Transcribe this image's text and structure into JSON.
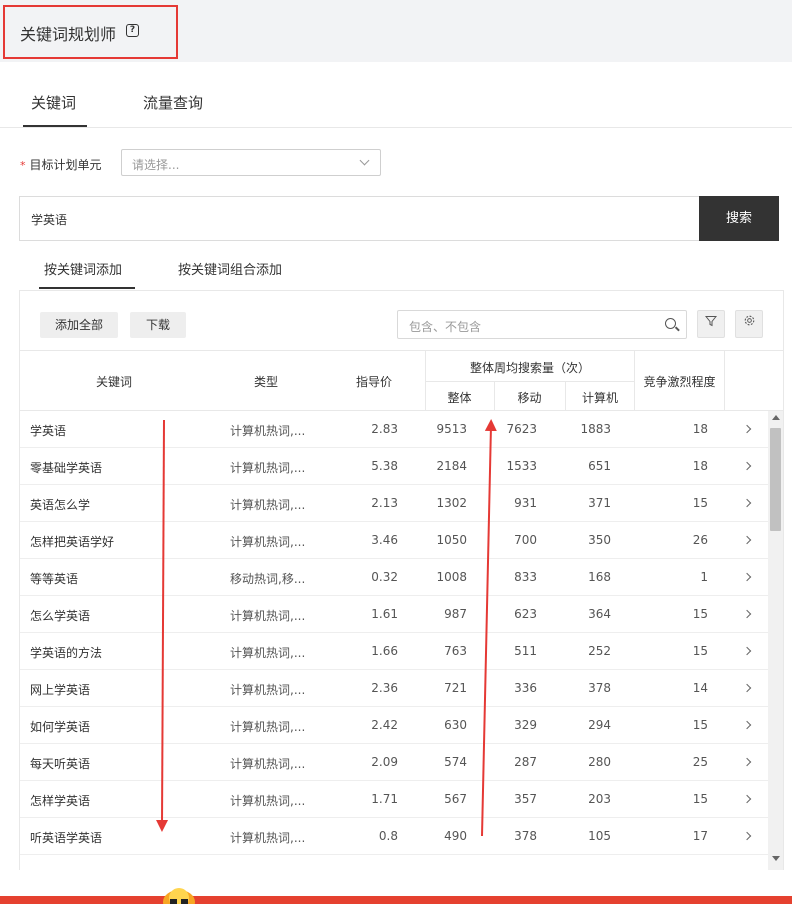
{
  "header": {
    "title": "关键词规划师"
  },
  "main_tabs": [
    {
      "label": "关键词"
    },
    {
      "label": "流量查询"
    }
  ],
  "target": {
    "label": "目标计划单元",
    "placeholder": "请选择..."
  },
  "search": {
    "value": "学英语",
    "button": "搜索"
  },
  "sub_tabs": [
    {
      "label": "按关键词添加"
    },
    {
      "label": "按关键词组合添加"
    }
  ],
  "toolbar": {
    "add_all": "添加全部",
    "download": "下载",
    "filter_placeholder": "包含、不包含"
  },
  "table": {
    "headers": {
      "keyword": "关键词",
      "type": "类型",
      "price": "指导价",
      "weekly_group": "整体周均搜索量（次）",
      "total": "整体",
      "mobile": "移动",
      "pc": "计算机",
      "competition": "竞争激烈程度"
    },
    "rows": [
      {
        "keyword": "学英语",
        "type": "计算机热词,...",
        "price": "2.83",
        "total": "9513",
        "mobile": "7623",
        "pc": "1883",
        "competition": "18"
      },
      {
        "keyword": "零基础学英语",
        "type": "计算机热词,...",
        "price": "5.38",
        "total": "2184",
        "mobile": "1533",
        "pc": "651",
        "competition": "18"
      },
      {
        "keyword": "英语怎么学",
        "type": "计算机热词,...",
        "price": "2.13",
        "total": "1302",
        "mobile": "931",
        "pc": "371",
        "competition": "15"
      },
      {
        "keyword": "怎样把英语学好",
        "type": "计算机热词,...",
        "price": "3.46",
        "total": "1050",
        "mobile": "700",
        "pc": "350",
        "competition": "26"
      },
      {
        "keyword": "等等英语",
        "type": "移动热词,移...",
        "price": "0.32",
        "total": "1008",
        "mobile": "833",
        "pc": "168",
        "competition": "1"
      },
      {
        "keyword": "怎么学英语",
        "type": "计算机热词,...",
        "price": "1.61",
        "total": "987",
        "mobile": "623",
        "pc": "364",
        "competition": "15"
      },
      {
        "keyword": "学英语的方法",
        "type": "计算机热词,...",
        "price": "1.66",
        "total": "763",
        "mobile": "511",
        "pc": "252",
        "competition": "15"
      },
      {
        "keyword": "网上学英语",
        "type": "计算机热词,...",
        "price": "2.36",
        "total": "721",
        "mobile": "336",
        "pc": "378",
        "competition": "14"
      },
      {
        "keyword": "如何学英语",
        "type": "计算机热词,...",
        "price": "2.42",
        "total": "630",
        "mobile": "329",
        "pc": "294",
        "competition": "15"
      },
      {
        "keyword": "每天听英语",
        "type": "计算机热词,...",
        "price": "2.09",
        "total": "574",
        "mobile": "287",
        "pc": "280",
        "competition": "25"
      },
      {
        "keyword": "怎样学英语",
        "type": "计算机热词,...",
        "price": "1.71",
        "total": "567",
        "mobile": "357",
        "pc": "203",
        "competition": "15"
      },
      {
        "keyword": "听英语学英语",
        "type": "计算机热词,...",
        "price": "0.8",
        "total": "490",
        "mobile": "378",
        "pc": "105",
        "competition": "17"
      }
    ]
  },
  "colors": {
    "accent_dark": "#333333",
    "annotation_red": "#e53935",
    "footer_red": "#e5412f"
  }
}
